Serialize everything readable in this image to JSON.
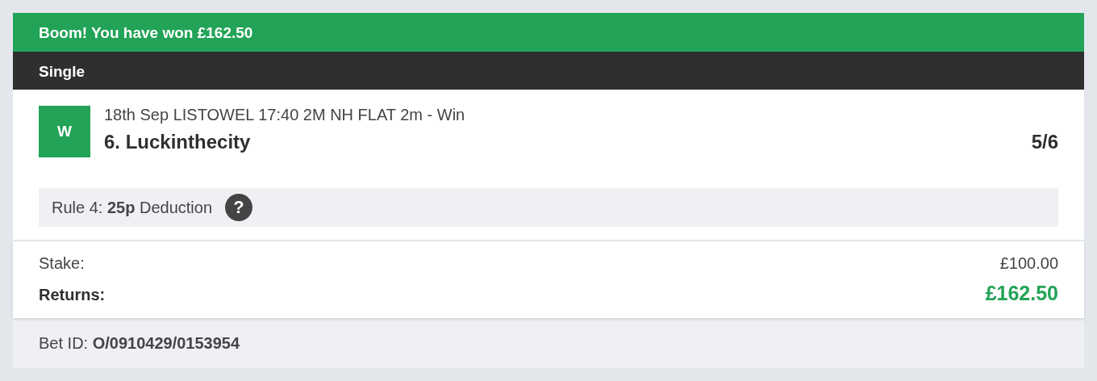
{
  "banner": {
    "title": "Boom! You have won £162.50"
  },
  "bet_type": "Single",
  "selection": {
    "badge": {
      "label": "W",
      "color": "#22a357"
    },
    "event": "18th Sep LISTOWEL 17:40 2M NH FLAT 2m - Win",
    "runner": "6. Luckinthecity",
    "odds": "5/6"
  },
  "rule4": {
    "text": "Rule 4: **25p** Deduction",
    "help_icon": "?"
  },
  "summary": [
    {
      "label": "Stake:",
      "value": "£100.00",
      "kind": "plain"
    },
    {
      "label": "Returns:",
      "value": "£162.50",
      "kind": "highlight"
    }
  ],
  "footer": "Bet ID: **O/0910429/0153954**"
}
